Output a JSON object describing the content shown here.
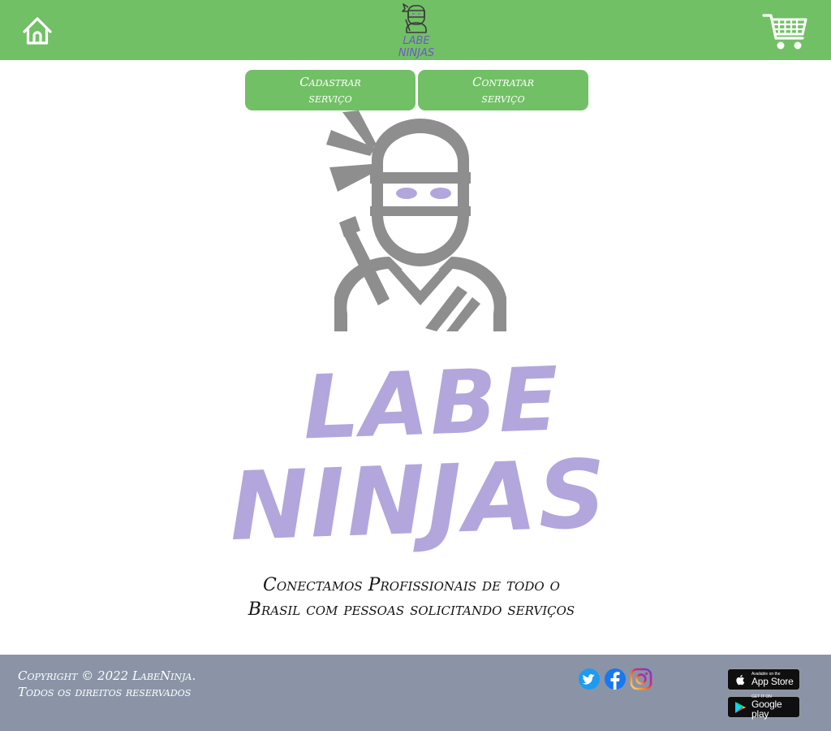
{
  "header": {
    "home_icon": "home-icon",
    "logo_text_line1": "LABE",
    "logo_text_line2": "NINJAS",
    "cart_icon": "shopping-cart-icon"
  },
  "actions": {
    "register_service_label": "Cadastrar serviço",
    "hire_service_label": "Contratar serviço"
  },
  "hero": {
    "logo_line1": "LABE",
    "logo_line2": "NINJAS",
    "tagline": "Conectamos Profissionais de todo o Brasil com pessoas solicitando serviços"
  },
  "footer": {
    "copyright_line1": "Copyright © 2022 LabeNinja.",
    "copyright_line2": "Todos os direitos reservados",
    "social": [
      "twitter-icon",
      "facebook-icon",
      "instagram-icon"
    ],
    "appstore_small": "Available on the",
    "appstore_big": "App Store",
    "googleplay_small": "GET IT ON",
    "googleplay_big": "Google play"
  },
  "colors": {
    "brand_green": "#71c065",
    "brand_purple": "#b3a6dc",
    "ninja_gray": "#8e8e8e",
    "footer_gray": "#8a94a6"
  }
}
